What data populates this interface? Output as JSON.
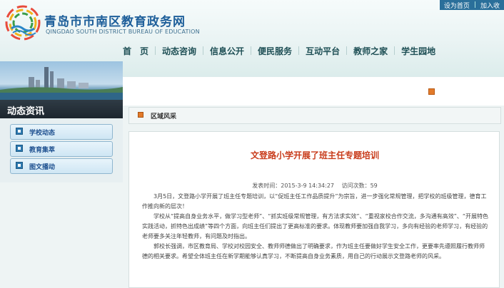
{
  "header": {
    "title": "青岛市市南区教育政务网",
    "subtitle": "QINGDAO SOUTH DISTRICT BUREAU OF EDUCATION",
    "top_links": [
      "设为首页",
      "加入收"
    ]
  },
  "nav": [
    "首　页",
    "动态咨询",
    "信息公开",
    "便民服务",
    "互动平台",
    "教师之家",
    "学生园地"
  ],
  "sidebar": {
    "heading": "动态资讯",
    "items": [
      "学校动态",
      "教育集萃",
      "图文播动"
    ]
  },
  "breadcrumb": "区域风采",
  "article": {
    "title": "文登路小学开展了班主任专题培训",
    "publish_label": "发表时间：",
    "publish_time": "2015-3-9 14:34:27",
    "views_label": "访问次数：",
    "views": "59",
    "paragraphs": [
      "3月5日，文登路小学开展了班主任专题培训，以“促班主任工作品质提升”为宗旨，进一步强化常规管理，把学校的班级管理，德育工作推向新的层次！",
      "学校从“提高自身业务水平，做学习型老师”、“抓实班级常规管理，有方法求实效”、“重视家校合作交流，多沟通有高效”、“开展特色实践活动，抓特色出成绩”等四个方面，向班主任们提出了更高标准的要求。体现教师要加强自我学习，多向有经验的老师学习，有经验的老师要多关注年轻教师，有问题及时指出。",
      "郭校长强调，市区教育局、学校对校园安全、教师师德做出了明确要求，作为班主任要做好学生安全工作，更要率先遵照履行教师师德的相关要求。希望全体班主任在新学期能够认真学习，不断提高自身业务素质，用自己的行动展示文登路老师的风采。"
    ]
  },
  "colors": {
    "title_blue": "#1e5f9a",
    "article_title": "#c83b1a",
    "nav_text": "#1e4f55",
    "accent_orange": "#e27a2a"
  }
}
